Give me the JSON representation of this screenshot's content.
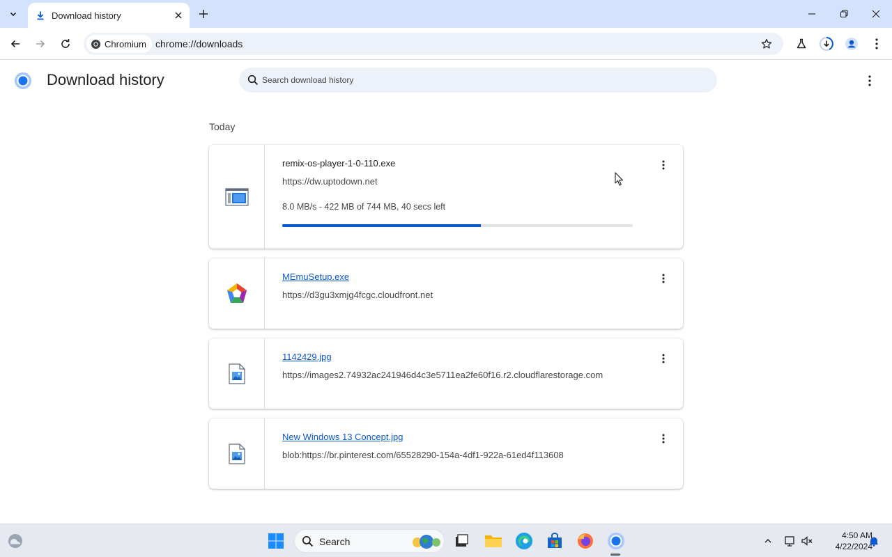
{
  "browser": {
    "tab_title": "Download history",
    "chip_label": "Chromium",
    "url": "chrome://downloads"
  },
  "page": {
    "title": "Download history",
    "search_placeholder": "Search download history",
    "section_label": "Today"
  },
  "downloads": [
    {
      "name": "remix-os-player-1-0-110.exe",
      "source": "https://dw.uptodown.net",
      "status": "8.0 MB/s - 422 MB of 744 MB, 40 secs left",
      "progress_fraction": 0.567,
      "icon": "exe-file-icon",
      "in_progress": true
    },
    {
      "name": "MEmuSetup.exe",
      "source": "https://d3gu3xmjg4fcgc.cloudfront.net",
      "icon": "memu-app-icon",
      "in_progress": false
    },
    {
      "name": "1142429.jpg",
      "source": "https://images2.74932ac241946d4c3e5711ea2fe60f16.r2.cloudflarestorage.com",
      "icon": "image-file-icon",
      "in_progress": false
    },
    {
      "name": "New Windows 13 Concept.jpg",
      "source": "blob:https://br.pinterest.com/65528290-154a-4df1-922a-61ed4f113608",
      "icon": "image-file-icon",
      "in_progress": false
    }
  ],
  "taskbar": {
    "search_label": "Search",
    "time": "4:50 AM",
    "date": "4/22/2024"
  },
  "colors": {
    "accent": "#0b57d0",
    "tabstrip": "#d3e3fd",
    "omnibox": "#edf2fa"
  }
}
